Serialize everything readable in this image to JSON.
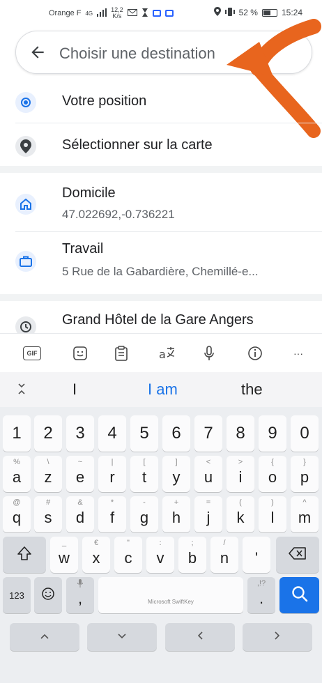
{
  "status_bar": {
    "carrier": "Orange F",
    "network": "4G",
    "speed_value": "12,2",
    "speed_unit": "K/s",
    "battery": "52 %",
    "time": "15:24"
  },
  "search": {
    "placeholder": "Choisir une destination"
  },
  "quick_options": [
    {
      "label": "Votre position",
      "icon": "my-location-icon"
    },
    {
      "label": "Sélectionner sur la carte",
      "icon": "map-pin-icon"
    }
  ],
  "saved_places": [
    {
      "title": "Domicile",
      "subtitle": "47.022692,-0.736221",
      "icon": "home-icon"
    },
    {
      "title": "Travail",
      "subtitle": "5 Rue de la Gabardière, Chemillé-e...",
      "icon": "briefcase-icon"
    }
  ],
  "recent": [
    {
      "title": "Grand Hôtel de la Gare Angers",
      "icon": "history-icon"
    }
  ],
  "keyboard": {
    "toolbar": [
      {
        "label": "GIF",
        "icon": "gif-icon"
      },
      {
        "icon": "sticker-icon"
      },
      {
        "icon": "clipboard-icon"
      },
      {
        "icon": "translate-icon"
      },
      {
        "icon": "mic-icon"
      },
      {
        "icon": "info-icon"
      },
      {
        "label": "···",
        "icon": "more-icon"
      }
    ],
    "suggestions": [
      "I",
      "I am",
      "the"
    ],
    "number_row": [
      "1",
      "2",
      "3",
      "4",
      "5",
      "6",
      "7",
      "8",
      "9",
      "0"
    ],
    "row1": [
      {
        "main": "a",
        "hint": "%"
      },
      {
        "main": "z",
        "hint": "\\"
      },
      {
        "main": "e",
        "hint": "~"
      },
      {
        "main": "r",
        "hint": "|"
      },
      {
        "main": "t",
        "hint": "["
      },
      {
        "main": "y",
        "hint": "]"
      },
      {
        "main": "u",
        "hint": "<"
      },
      {
        "main": "i",
        "hint": ">"
      },
      {
        "main": "o",
        "hint": "{"
      },
      {
        "main": "p",
        "hint": "}"
      }
    ],
    "row2": [
      {
        "main": "q",
        "hint": "@"
      },
      {
        "main": "s",
        "hint": "#"
      },
      {
        "main": "d",
        "hint": "&"
      },
      {
        "main": "f",
        "hint": "*"
      },
      {
        "main": "g",
        "hint": "-"
      },
      {
        "main": "h",
        "hint": "+"
      },
      {
        "main": "j",
        "hint": "="
      },
      {
        "main": "k",
        "hint": "("
      },
      {
        "main": "l",
        "hint": ")"
      },
      {
        "main": "m",
        "hint": "^"
      }
    ],
    "row3": [
      {
        "main": "w",
        "hint": "_"
      },
      {
        "main": "x",
        "hint": "€"
      },
      {
        "main": "c",
        "hint": "\""
      },
      {
        "main": "v",
        "hint": ":"
      },
      {
        "main": "b",
        "hint": ";"
      },
      {
        "main": "n",
        "hint": "/"
      },
      {
        "main": "'",
        "hint": ""
      }
    ],
    "numbers_key": "123",
    "comma_key": ",",
    "period_key": ".",
    "period_hint": ",!?",
    "space_label": "Microsoft SwiftKey"
  },
  "colors": {
    "accent": "#1a73e8",
    "overlay_arrow": "#e8651e"
  }
}
